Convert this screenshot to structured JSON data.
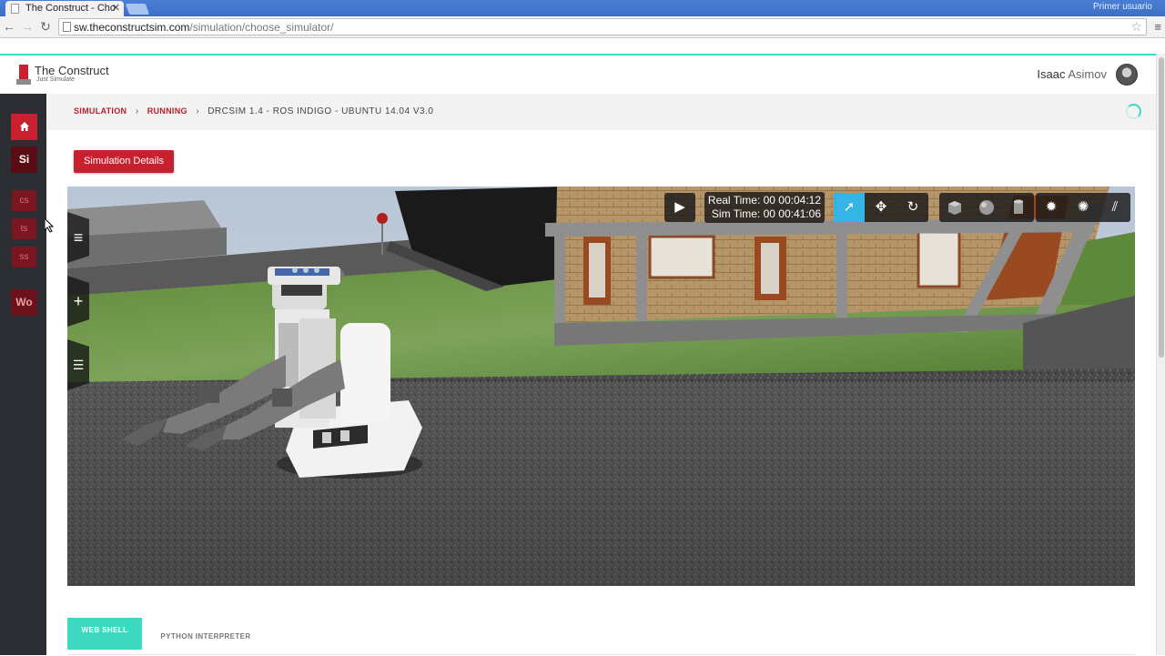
{
  "browser": {
    "tab_title": "The Construct - Cho",
    "profile_label": "Primer usuario",
    "url_host": "sw.theconstructsim.com",
    "url_path": "/simulation/choose_simulator/"
  },
  "header": {
    "logo_title": "The Construct",
    "logo_subtitle": "Just Simulate",
    "user_first": "Isaac",
    "user_last": "Asimov"
  },
  "rail": {
    "items": [
      {
        "label": "",
        "icon": "home-icon"
      },
      {
        "label": "Si"
      },
      {
        "label": "cs"
      },
      {
        "label": "ts"
      },
      {
        "label": "ss"
      },
      {
        "label": "Wo"
      }
    ]
  },
  "breadcrumb": {
    "items": [
      "SIMULATION",
      "RUNNING"
    ],
    "current": "DRCSIM 1.4 - ROS INDIGO - UBUNTU 14.04 V3.0"
  },
  "actions": {
    "details_label": "Simulation Details"
  },
  "sim": {
    "real_time": "Real Time: 00 00:04:12",
    "sim_time": "Sim Time: 00 00:41:06",
    "toolbar_icons": [
      "play-icon",
      "select-arrow-icon",
      "translate-icon",
      "rotate-icon",
      "box-icon",
      "sphere-icon",
      "cylinder-icon",
      "point-light-icon",
      "spot-light-icon",
      "directional-light-icon"
    ],
    "side_icons": [
      "menu-icon",
      "insert-icon",
      "tree-icon"
    ]
  },
  "bottom_tabs": [
    {
      "label": "WEB SHELL",
      "active": true
    },
    {
      "label": "PYTHON INTERPRETER",
      "active": false
    }
  ],
  "colors": {
    "brand_red": "#c8202f",
    "accent_teal": "#3dd9c1",
    "toolbar_active": "#33b5e5"
  }
}
